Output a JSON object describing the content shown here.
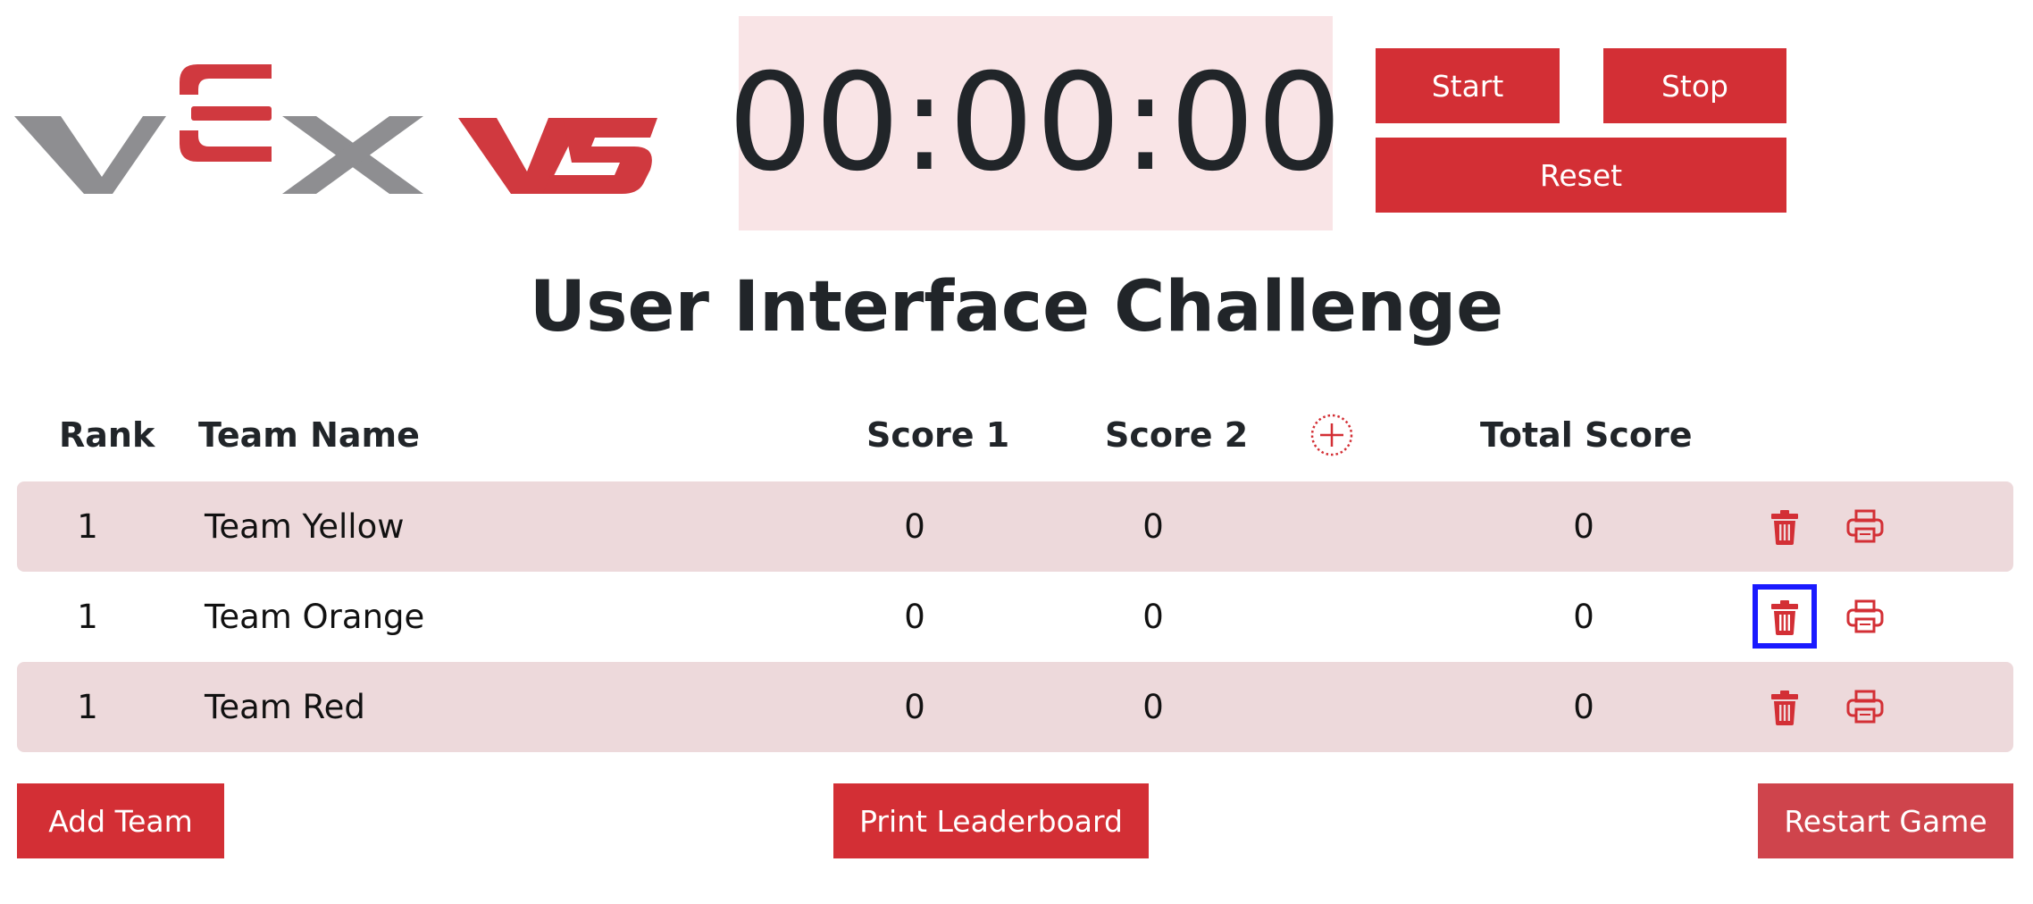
{
  "logo": {
    "text_vex": "VEX",
    "text_v5": "V5",
    "colors": {
      "gray": "#8e8e91",
      "red": "#d0393f"
    }
  },
  "timer": {
    "display": "00:00:00"
  },
  "controls": {
    "start_label": "Start",
    "stop_label": "Stop",
    "reset_label": "Reset"
  },
  "title": "User Interface Challenge",
  "table": {
    "headers": {
      "rank": "Rank",
      "team_name": "Team Name",
      "score1": "Score 1",
      "score2": "Score 2",
      "add_column_icon": "add-circle-icon",
      "total": "Total Score"
    },
    "rows": [
      {
        "rank": "1",
        "team": "Team Yellow",
        "score1": "0",
        "score2": "0",
        "total": "0",
        "delete_icon": "trash-icon",
        "print_icon": "printer-icon"
      },
      {
        "rank": "1",
        "team": "Team Orange",
        "score1": "0",
        "score2": "0",
        "total": "0",
        "delete_icon": "trash-icon",
        "print_icon": "printer-icon"
      },
      {
        "rank": "1",
        "team": "Team Red",
        "score1": "0",
        "score2": "0",
        "total": "0",
        "delete_icon": "trash-icon",
        "print_icon": "printer-icon"
      }
    ]
  },
  "footer": {
    "add_team_label": "Add Team",
    "print_leaderboard_label": "Print Leaderboard",
    "restart_game_label": "Restart Game"
  },
  "colors": {
    "accent": "#d32f35",
    "restart_button": "#cf444c",
    "timer_background": "#f9e4e6",
    "row_shade": "#edd9db",
    "focus_outline": "#1a1aff"
  }
}
